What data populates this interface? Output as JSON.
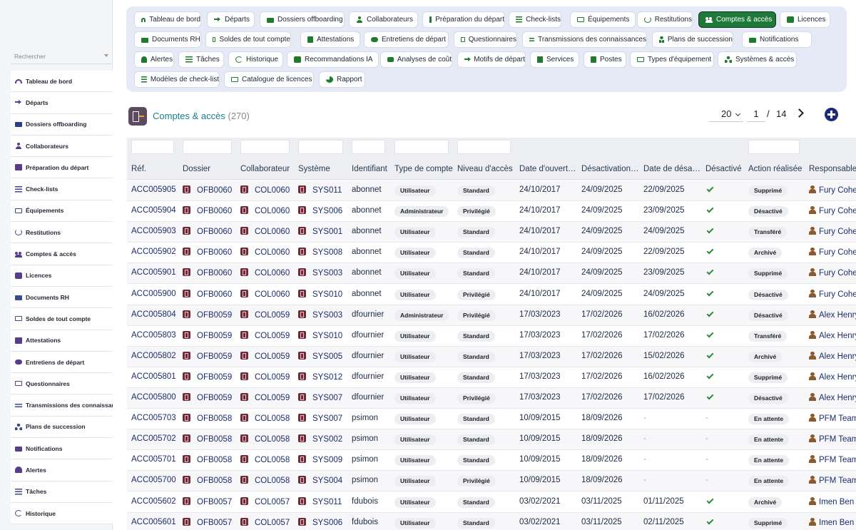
{
  "sidebar": {
    "search_placeholder": "Rechercher",
    "items": [
      {
        "label": "Tableau de bord",
        "icon": "gauge-icon"
      },
      {
        "label": "Départs",
        "icon": "arrow-right-icon"
      },
      {
        "label": "Dossiers offboarding",
        "icon": "folder-icon"
      },
      {
        "label": "Collaborateurs",
        "icon": "user-icon"
      },
      {
        "label": "Préparation du départ",
        "icon": "clipboard-icon"
      },
      {
        "label": "Check-lists",
        "icon": "list-icon"
      },
      {
        "label": "Équipements",
        "icon": "laptop-icon"
      },
      {
        "label": "Restitutions",
        "icon": "undo-icon"
      },
      {
        "label": "Comptes & accès",
        "icon": "users-icon"
      },
      {
        "label": "Licences",
        "icon": "key-icon"
      },
      {
        "label": "Documents RH",
        "icon": "folder-icon"
      },
      {
        "label": "Soldes de tout compte",
        "icon": "card-icon"
      },
      {
        "label": "Attestations",
        "icon": "document-icon"
      },
      {
        "label": "Entretiens de départ",
        "icon": "chat-icon"
      },
      {
        "label": "Questionnaires",
        "icon": "poll-icon"
      },
      {
        "label": "Transmissions des connaissances",
        "icon": "swap-icon"
      },
      {
        "label": "Plans de succession",
        "icon": "tree-icon"
      },
      {
        "label": "Notifications",
        "icon": "mail-icon"
      },
      {
        "label": "Alertes",
        "icon": "bell-icon"
      },
      {
        "label": "Tâches",
        "icon": "list-icon"
      },
      {
        "label": "Historique",
        "icon": "history-icon"
      }
    ]
  },
  "tabs": [
    {
      "label": "Tableau de bord",
      "icon": "gauge-icon"
    },
    {
      "label": "Départs",
      "icon": "arrow-right-icon"
    },
    {
      "label": "Dossiers offboarding",
      "icon": "folder-icon"
    },
    {
      "label": "Collaborateurs",
      "icon": "user-icon"
    },
    {
      "label": "Préparation du départ",
      "icon": "clipboard-icon"
    },
    {
      "label": "Check-lists",
      "icon": "list-icon"
    },
    {
      "label": "Équipements",
      "icon": "laptop-icon"
    },
    {
      "label": "Restitutions",
      "icon": "undo-icon"
    },
    {
      "label": "Comptes & accès",
      "icon": "users-icon",
      "active": true
    },
    {
      "label": "Licences",
      "icon": "key-icon"
    },
    {
      "label": "Documents RH",
      "icon": "folder-icon"
    },
    {
      "label": "Soldes de tout compte",
      "icon": "card-icon"
    },
    {
      "label": "Attestations",
      "icon": "document-icon"
    },
    {
      "label": "Entretiens de départ",
      "icon": "chat-icon"
    },
    {
      "label": "Questionnaires",
      "icon": "poll-icon"
    },
    {
      "label": "Transmissions des connaissances",
      "icon": "swap-icon"
    },
    {
      "label": "Plans de succession",
      "icon": "tree-icon"
    },
    {
      "label": "Notifications",
      "icon": "mail-icon"
    },
    {
      "label": "Alertes",
      "icon": "bell-icon"
    },
    {
      "label": "Tâches",
      "icon": "list-icon"
    },
    {
      "label": "Historique",
      "icon": "history-icon"
    },
    {
      "label": "Recommandations IA",
      "icon": "robot-icon"
    },
    {
      "label": "Analyses de coût",
      "icon": "coins-icon"
    },
    {
      "label": "Motifs de départ",
      "icon": "arrow-right-icon"
    },
    {
      "label": "Services",
      "icon": "building-icon"
    },
    {
      "label": "Postes",
      "icon": "badge-icon"
    },
    {
      "label": "Types d'équipement",
      "icon": "laptop-icon"
    },
    {
      "label": "Systèmes & accès",
      "icon": "network-icon"
    },
    {
      "label": "Modèles de check-list",
      "icon": "list-icon"
    },
    {
      "label": "Catalogue de licences",
      "icon": "card-icon"
    },
    {
      "label": "Rapport",
      "icon": "pie-chart-icon"
    }
  ],
  "header": {
    "title": "Comptes & accès",
    "count": "(270)",
    "per_page": "20",
    "page": "1",
    "page_sep": "/",
    "total_pages": "14"
  },
  "table": {
    "columns": [
      "Réf.",
      "Dossier",
      "Collaborateur",
      "Système",
      "Identifiant",
      "Type de compte",
      "Niveau d'accès",
      "Date d'ouverture",
      "Désactivation prévue",
      "Date de désactivation",
      "Désactivé",
      "Action réalisée",
      "Responsable"
    ],
    "rows": [
      {
        "ref": "ACC005905",
        "dossier": "OFB0060",
        "collab": "COL0060",
        "systeme": "SYS011",
        "ident": "abonnet",
        "type": "Utilisateur",
        "niveau": "Standard",
        "ouverture": "24/10/2017",
        "prevue": "24/09/2025",
        "desact": "22/09/2025",
        "desactive": true,
        "action": "Supprimé",
        "resp": "Fury Cohen"
      },
      {
        "ref": "ACC005904",
        "dossier": "OFB0060",
        "collab": "COL0060",
        "systeme": "SYS006",
        "ident": "abonnet",
        "type": "Administrateur",
        "niveau": "Privilégié",
        "ouverture": "24/10/2017",
        "prevue": "24/09/2025",
        "desact": "23/09/2025",
        "desactive": true,
        "action": "Désactivé",
        "resp": "Fury Cohen"
      },
      {
        "ref": "ACC005903",
        "dossier": "OFB0060",
        "collab": "COL0060",
        "systeme": "SYS001",
        "ident": "abonnet",
        "type": "Utilisateur",
        "niveau": "Standard",
        "ouverture": "24/10/2017",
        "prevue": "24/09/2025",
        "desact": "24/09/2025",
        "desactive": true,
        "action": "Transféré",
        "resp": "Fury Cohen"
      },
      {
        "ref": "ACC005902",
        "dossier": "OFB0060",
        "collab": "COL0060",
        "systeme": "SYS008",
        "ident": "abonnet",
        "type": "Utilisateur",
        "niveau": "Standard",
        "ouverture": "24/10/2017",
        "prevue": "24/09/2025",
        "desact": "22/09/2025",
        "desactive": true,
        "action": "Archivé",
        "resp": "Fury Cohen"
      },
      {
        "ref": "ACC005901",
        "dossier": "OFB0060",
        "collab": "COL0060",
        "systeme": "SYS003",
        "ident": "abonnet",
        "type": "Utilisateur",
        "niveau": "Standard",
        "ouverture": "24/10/2017",
        "prevue": "24/09/2025",
        "desact": "23/09/2025",
        "desactive": true,
        "action": "Supprimé",
        "resp": "Fury Cohen"
      },
      {
        "ref": "ACC005900",
        "dossier": "OFB0060",
        "collab": "COL0060",
        "systeme": "SYS010",
        "ident": "abonnet",
        "type": "Utilisateur",
        "niveau": "Privilégié",
        "ouverture": "24/10/2017",
        "prevue": "24/09/2025",
        "desact": "24/09/2025",
        "desactive": true,
        "action": "Désactivé",
        "resp": "Fury Cohen"
      },
      {
        "ref": "ACC005804",
        "dossier": "OFB0059",
        "collab": "COL0059",
        "systeme": "SYS003",
        "ident": "dfournier",
        "type": "Administrateur",
        "niveau": "Privilégié",
        "ouverture": "17/03/2023",
        "prevue": "17/02/2026",
        "desact": "16/02/2026",
        "desactive": true,
        "action": "Désactivé",
        "resp": "Alex Henry"
      },
      {
        "ref": "ACC005803",
        "dossier": "OFB0059",
        "collab": "COL0059",
        "systeme": "SYS010",
        "ident": "dfournier",
        "type": "Utilisateur",
        "niveau": "Standard",
        "ouverture": "17/03/2023",
        "prevue": "17/02/2026",
        "desact": "17/02/2026",
        "desactive": true,
        "action": "Transféré",
        "resp": "Alex Henry"
      },
      {
        "ref": "ACC005802",
        "dossier": "OFB0059",
        "collab": "COL0059",
        "systeme": "SYS005",
        "ident": "dfournier",
        "type": "Utilisateur",
        "niveau": "Standard",
        "ouverture": "17/03/2023",
        "prevue": "17/02/2026",
        "desact": "15/02/2026",
        "desactive": true,
        "action": "Archivé",
        "resp": "Alex Henry"
      },
      {
        "ref": "ACC005801",
        "dossier": "OFB0059",
        "collab": "COL0059",
        "systeme": "SYS012",
        "ident": "dfournier",
        "type": "Utilisateur",
        "niveau": "Standard",
        "ouverture": "17/03/2023",
        "prevue": "17/02/2026",
        "desact": "16/02/2026",
        "desactive": true,
        "action": "Supprimé",
        "resp": "Alex Henry"
      },
      {
        "ref": "ACC005800",
        "dossier": "OFB0059",
        "collab": "COL0059",
        "systeme": "SYS007",
        "ident": "dfournier",
        "type": "Utilisateur",
        "niveau": "Privilégié",
        "ouverture": "17/03/2023",
        "prevue": "17/02/2026",
        "desact": "17/02/2026",
        "desactive": true,
        "action": "Désactivé",
        "resp": "Alex Henry"
      },
      {
        "ref": "ACC005703",
        "dossier": "OFB0058",
        "collab": "COL0058",
        "systeme": "SYS007",
        "ident": "psimon",
        "type": "Utilisateur",
        "niveau": "Standard",
        "ouverture": "10/09/2015",
        "prevue": "18/09/2026",
        "desact": "-",
        "desactive": false,
        "action": "En attente",
        "resp": "PFM Team"
      },
      {
        "ref": "ACC005702",
        "dossier": "OFB0058",
        "collab": "COL0058",
        "systeme": "SYS002",
        "ident": "psimon",
        "type": "Utilisateur",
        "niveau": "Standard",
        "ouverture": "10/09/2015",
        "prevue": "18/09/2026",
        "desact": "-",
        "desactive": false,
        "action": "En attente",
        "resp": "PFM Team"
      },
      {
        "ref": "ACC005701",
        "dossier": "OFB0058",
        "collab": "COL0058",
        "systeme": "SYS009",
        "ident": "psimon",
        "type": "Utilisateur",
        "niveau": "Standard",
        "ouverture": "10/09/2015",
        "prevue": "18/09/2026",
        "desact": "-",
        "desactive": false,
        "action": "En attente",
        "resp": "PFM Team"
      },
      {
        "ref": "ACC005700",
        "dossier": "OFB0058",
        "collab": "COL0058",
        "systeme": "SYS004",
        "ident": "psimon",
        "type": "Utilisateur",
        "niveau": "Privilégié",
        "ouverture": "10/09/2015",
        "prevue": "18/09/2026",
        "desact": "-",
        "desactive": false,
        "action": "En attente",
        "resp": "PFM Team"
      },
      {
        "ref": "ACC005602",
        "dossier": "OFB0057",
        "collab": "COL0057",
        "systeme": "SYS011",
        "ident": "fdubois",
        "type": "Utilisateur",
        "niveau": "Standard",
        "ouverture": "03/02/2021",
        "prevue": "03/11/2025",
        "desact": "01/11/2025",
        "desactive": true,
        "action": "Archivé",
        "resp": "Imen Ben"
      },
      {
        "ref": "ACC005601",
        "dossier": "OFB0057",
        "collab": "COL0057",
        "systeme": "SYS006",
        "ident": "fdubois",
        "type": "Utilisateur",
        "niveau": "Standard",
        "ouverture": "03/02/2021",
        "prevue": "03/11/2025",
        "desact": "02/11/2025",
        "desactive": true,
        "action": "Supprimé",
        "resp": "Imen Ben"
      }
    ]
  },
  "dash": "-"
}
